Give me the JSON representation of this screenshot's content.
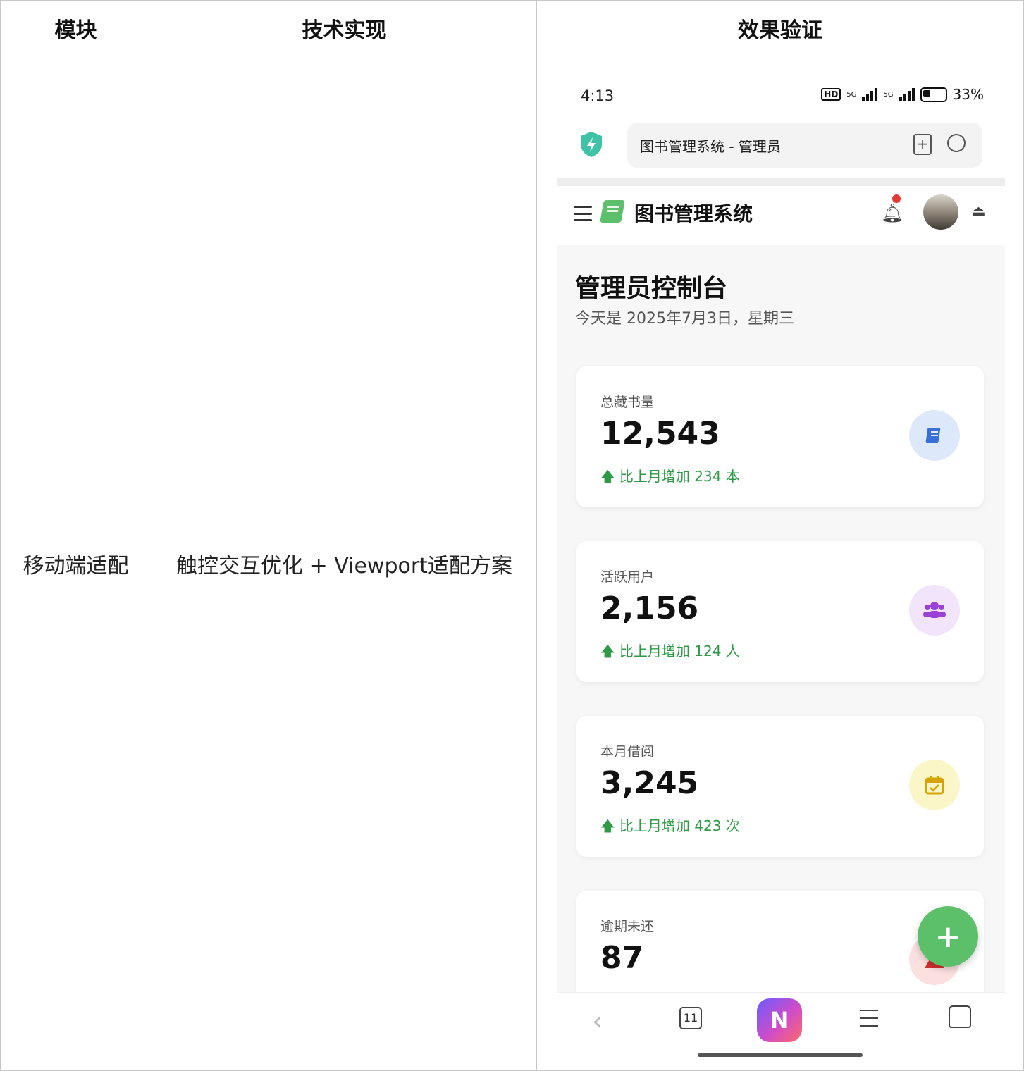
{
  "table": {
    "headers": [
      "模块",
      "技术实现",
      "效果验证"
    ],
    "row": {
      "module": "移动端适配",
      "technique": "触控交互优化 + Viewport适配方案"
    }
  },
  "phone": {
    "status_bar": {
      "time": "4:13",
      "network": "5G",
      "battery": "33%"
    },
    "browser": {
      "url_title": "图书管理系统 - 管理员",
      "tab_count": "11",
      "ai_button_label": "N"
    },
    "app": {
      "title": "图书管理系统",
      "page_title": "管理员控制台",
      "date_line": "今天是 2025年7月3日，星期三",
      "cards": [
        {
          "label": "总藏书量",
          "value": "12,543",
          "change": "比上月增加 234 本",
          "icon": "book-icon",
          "icon_bg": "#dde8fb",
          "icon_color": "#3b6fd8"
        },
        {
          "label": "活跃用户",
          "value": "2,156",
          "change": "比上月增加 124 人",
          "icon": "users-icon",
          "icon_bg": "#f1e4fb",
          "icon_color": "#9b3fd6"
        },
        {
          "label": "本月借阅",
          "value": "3,245",
          "change": "比上月增加 423 次",
          "icon": "calendar-check-icon",
          "icon_bg": "#fbf6c8",
          "icon_color": "#d6a400"
        },
        {
          "label": "逾期未还",
          "value": "87",
          "change": "",
          "icon": "alert-icon",
          "icon_bg": "#fbe0e0",
          "icon_color": "#d32f2f"
        }
      ],
      "fab_label": "+"
    },
    "colors": {
      "accent_green": "#5cbf6a",
      "positive": "#2e9a45",
      "notification_dot": "#e53935"
    }
  }
}
